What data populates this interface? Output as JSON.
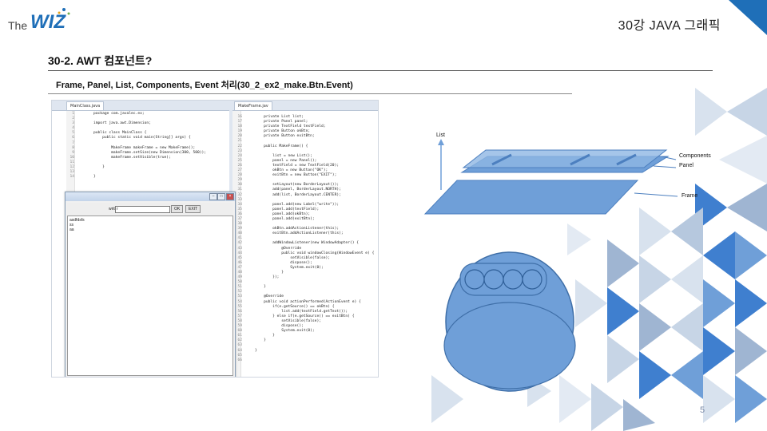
{
  "header": {
    "logo_text_the": "The",
    "logo_text_wiz": "WIZ",
    "title": "30강 JAVA 그래픽"
  },
  "section": {
    "title": "30-2. AWT 컴포넌트?"
  },
  "subtitle": "Frame, Panel, List, Components, Event 처리(30_2_ex2_make.Btn.Event)",
  "colors": {
    "accent": "#1f6fb8",
    "diagram_fill": "#6f9fd8",
    "tri_light": "#d8e2ee",
    "tri_mid": "#9fb5d2",
    "tri_dark": "#3f7fcf"
  },
  "ide": {
    "left_tab": "MainClass.java",
    "right_tab": "MakeFrame.jav",
    "left_code": [
      "package com.javalec.ex;",
      "",
      "import java.awt.Dimension;",
      "",
      "public class MainClass {",
      "    public static void main(String[] args) {",
      "",
      "        MakeFrame makeFrame = new MakeFrame();",
      "        makeFrame.setSize(new Dimension(300, 500));",
      "        makeFrame.setVisible(true);",
      "",
      "    }",
      "",
      "}"
    ],
    "left_line_numbers": [
      "1",
      "2",
      "3",
      "4",
      "5",
      "6",
      "7",
      "8",
      "9",
      "10",
      "11",
      "12",
      "13",
      "14"
    ],
    "right_line_numbers": [
      "16",
      "17",
      "18",
      "19",
      "20",
      "21",
      "22",
      "23",
      "24",
      "25",
      "26",
      "27",
      "28",
      "29",
      "30",
      "31",
      "32",
      "33",
      "34",
      "35",
      "36",
      "37",
      "38",
      "39",
      "40",
      "41",
      "42",
      "43",
      "44",
      "45",
      "46",
      "47",
      "48",
      "49",
      "50",
      "51",
      "52",
      "53",
      "54",
      "55",
      "56",
      "57",
      "58",
      "59",
      "60",
      "61",
      "62",
      "63",
      "64",
      "65",
      "66"
    ],
    "right_code": [
      "    private List list;",
      "    private Panel panel;",
      "    private TextField textField;",
      "    private Button okBtn;",
      "    private Button exitBtn;",
      "",
      "    public MakeFrame() {",
      "",
      "        list = new List();",
      "        panel = new Panel();",
      "        textField = new TextField(20);",
      "        okBtn = new Button(\"OK\");",
      "        exitBtn = new Button(\"EXIT\");",
      "",
      "        setLayout(new BorderLayout());",
      "        add(panel, BorderLayout.NORTH);",
      "        add(list, BorderLayout.CENTER);",
      "",
      "        panel.add(new Label(\"write\"));",
      "        panel.add(textField);",
      "        panel.add(okBtn);",
      "        panel.add(exitBtn);",
      "",
      "        okBtn.addActionListener(this);",
      "        exitBtn.addActionListener(this);",
      "",
      "        addWindowListener(new WindowAdapter() {",
      "            @Override",
      "            public void windowClosing(WindowEvent e) {",
      "                setVisible(false);",
      "                dispose();",
      "                System.exit(0);",
      "            }",
      "        });",
      "",
      "    }",
      "",
      "    @Override",
      "    public void actionPerformed(ActionEvent e) {",
      "        if(e.getSource() == okBtn) {",
      "            list.add(textField.getText());",
      "        } else if(e.getSource() == exitBtn) {",
      "            setVisible(false);",
      "            dispose();",
      "            System.exit(0);",
      "        }",
      "    }",
      "",
      "}",
      "",
      ""
    ]
  },
  "app_window": {
    "label": "write",
    "field_value": "r",
    "ok_button": "OK",
    "exit_button": "EXIT",
    "list_items": [
      "asdfdsfs",
      "ss",
      "aa"
    ]
  },
  "diagram": {
    "label_list": "List",
    "label_components": "Components",
    "label_panel": "Panel",
    "label_frame": "Frame"
  },
  "page_number": "5"
}
